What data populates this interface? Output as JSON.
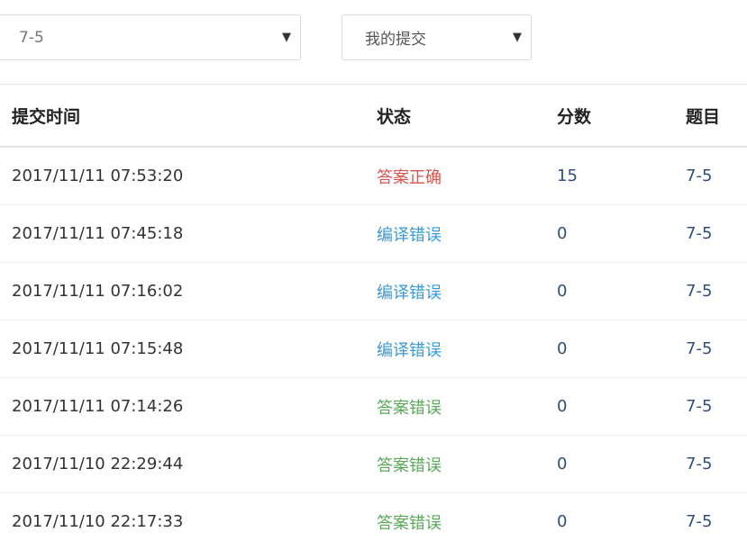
{
  "filters": {
    "problem_select": {
      "value": "7-5"
    },
    "scope_select": {
      "value": "我的提交"
    },
    "arrow_glyph": "▼"
  },
  "table": {
    "headers": {
      "time": "提交时间",
      "status": "状态",
      "score": "分数",
      "problem": "题目"
    },
    "rows": [
      {
        "time": "2017/11/11 07:53:20",
        "status": "答案正确",
        "status_kind": "correct",
        "score": "15",
        "problem": "7-5"
      },
      {
        "time": "2017/11/11 07:45:18",
        "status": "编译错误",
        "status_kind": "compile",
        "score": "0",
        "problem": "7-5"
      },
      {
        "time": "2017/11/11 07:16:02",
        "status": "编译错误",
        "status_kind": "compile",
        "score": "0",
        "problem": "7-5"
      },
      {
        "time": "2017/11/11 07:15:48",
        "status": "编译错误",
        "status_kind": "compile",
        "score": "0",
        "problem": "7-5"
      },
      {
        "time": "2017/11/11 07:14:26",
        "status": "答案错误",
        "status_kind": "wrong",
        "score": "0",
        "problem": "7-5"
      },
      {
        "time": "2017/11/10 22:29:44",
        "status": "答案错误",
        "status_kind": "wrong",
        "score": "0",
        "problem": "7-5"
      },
      {
        "time": "2017/11/10 22:17:33",
        "status": "答案错误",
        "status_kind": "wrong",
        "score": "0",
        "problem": "7-5"
      }
    ]
  },
  "colors": {
    "correct": "#d9534f",
    "compile": "#3a9ad9",
    "wrong": "#5aa95a",
    "link": "#2f4f7a"
  }
}
